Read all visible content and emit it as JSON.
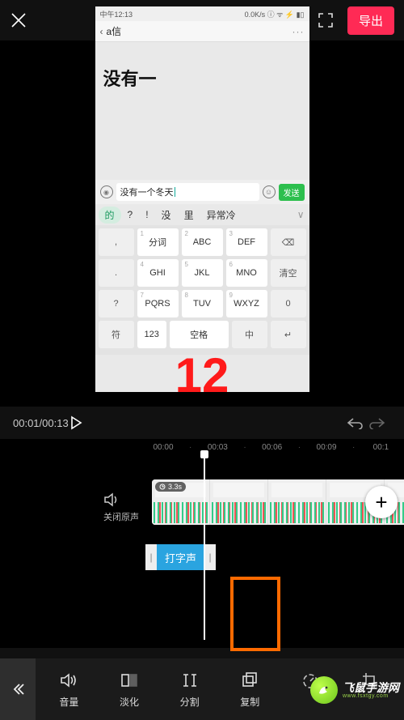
{
  "topbar": {
    "export_label": "导出"
  },
  "phone": {
    "status_left": "中午12:13",
    "status_right": "0.0K/s ⓘ ᯤ ⚡ ▮▯",
    "header_title": "a信",
    "body_text": "没有一",
    "input_value": "没有一个冬天",
    "send_label": "发送",
    "candidates": [
      "的",
      "?",
      "!",
      "没",
      "里",
      "异常冷"
    ],
    "keypad": {
      "r1": [
        ",",
        "分词",
        "ABC",
        "DEF",
        "⌫"
      ],
      "r2": [
        ".",
        "GHI",
        "JKL",
        "MNO",
        "清空"
      ],
      "r3": [
        "?",
        "PQRS",
        "TUV",
        "WXYZ",
        "0"
      ],
      "r4": [
        "符",
        "123",
        "空格",
        "中",
        "↵"
      ],
      "nums_r1": [
        "",
        "1",
        "2",
        "3",
        ""
      ],
      "nums_r2": [
        "",
        "4",
        "5",
        "6",
        ""
      ],
      "nums_r3": [
        "",
        "7",
        "8",
        "9",
        ""
      ]
    }
  },
  "annotation_number": "12",
  "playback": {
    "time_display": "00:01/00:13"
  },
  "timeline": {
    "ruler": [
      "00:00",
      "00:03",
      "00:06",
      "00:09",
      "00:1"
    ],
    "mute_label": "关闭原声",
    "duration_badge": "3.3s",
    "clip_label": "打字声"
  },
  "toolbar": {
    "items": [
      {
        "label": "音量",
        "icon": "volume"
      },
      {
        "label": "淡化",
        "icon": "fade"
      },
      {
        "label": "分割",
        "icon": "split"
      },
      {
        "label": "复制",
        "icon": "copy"
      },
      {
        "label": "",
        "icon": "speed"
      },
      {
        "label": "",
        "icon": "crop"
      }
    ]
  },
  "watermark": {
    "line1": "飞鼠手游网",
    "line2": "www.fsxtgy.com"
  }
}
